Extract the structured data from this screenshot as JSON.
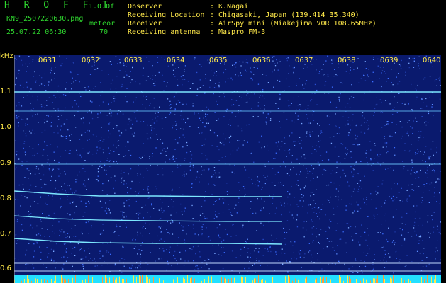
{
  "header": {
    "app_title": "H R O F F T",
    "version": "1.0.0f",
    "filename": "KN9_2507220630.png",
    "mode": "meteor",
    "datetime": "25.07.22 06:30",
    "count": "70",
    "rows": [
      {
        "label": "Observer",
        "value": "K.Nagai"
      },
      {
        "label": "Receiving Location",
        "value": "Chigasaki, Japan (139.414 35.340)"
      },
      {
        "label": "Receiver",
        "value": "AirSpy mini (Miakejima VOR 108.65MHz)"
      },
      {
        "label": "Receiving antenna",
        "value": "Maspro FM-3"
      }
    ]
  },
  "spectrogram": {
    "y_unit": "kHz",
    "y_ticks": [
      "1.1",
      "1.0",
      "0.9",
      "0.8",
      "0.7",
      "0.6"
    ],
    "x_ticks": [
      "0631",
      "0632",
      "0633",
      "0634",
      "0635",
      "0636",
      "0637",
      "0638",
      "0639",
      "0640"
    ],
    "background": "#0a1a6e",
    "line_color": "#7de8ff",
    "bottom_band": "#24e0ff"
  }
}
